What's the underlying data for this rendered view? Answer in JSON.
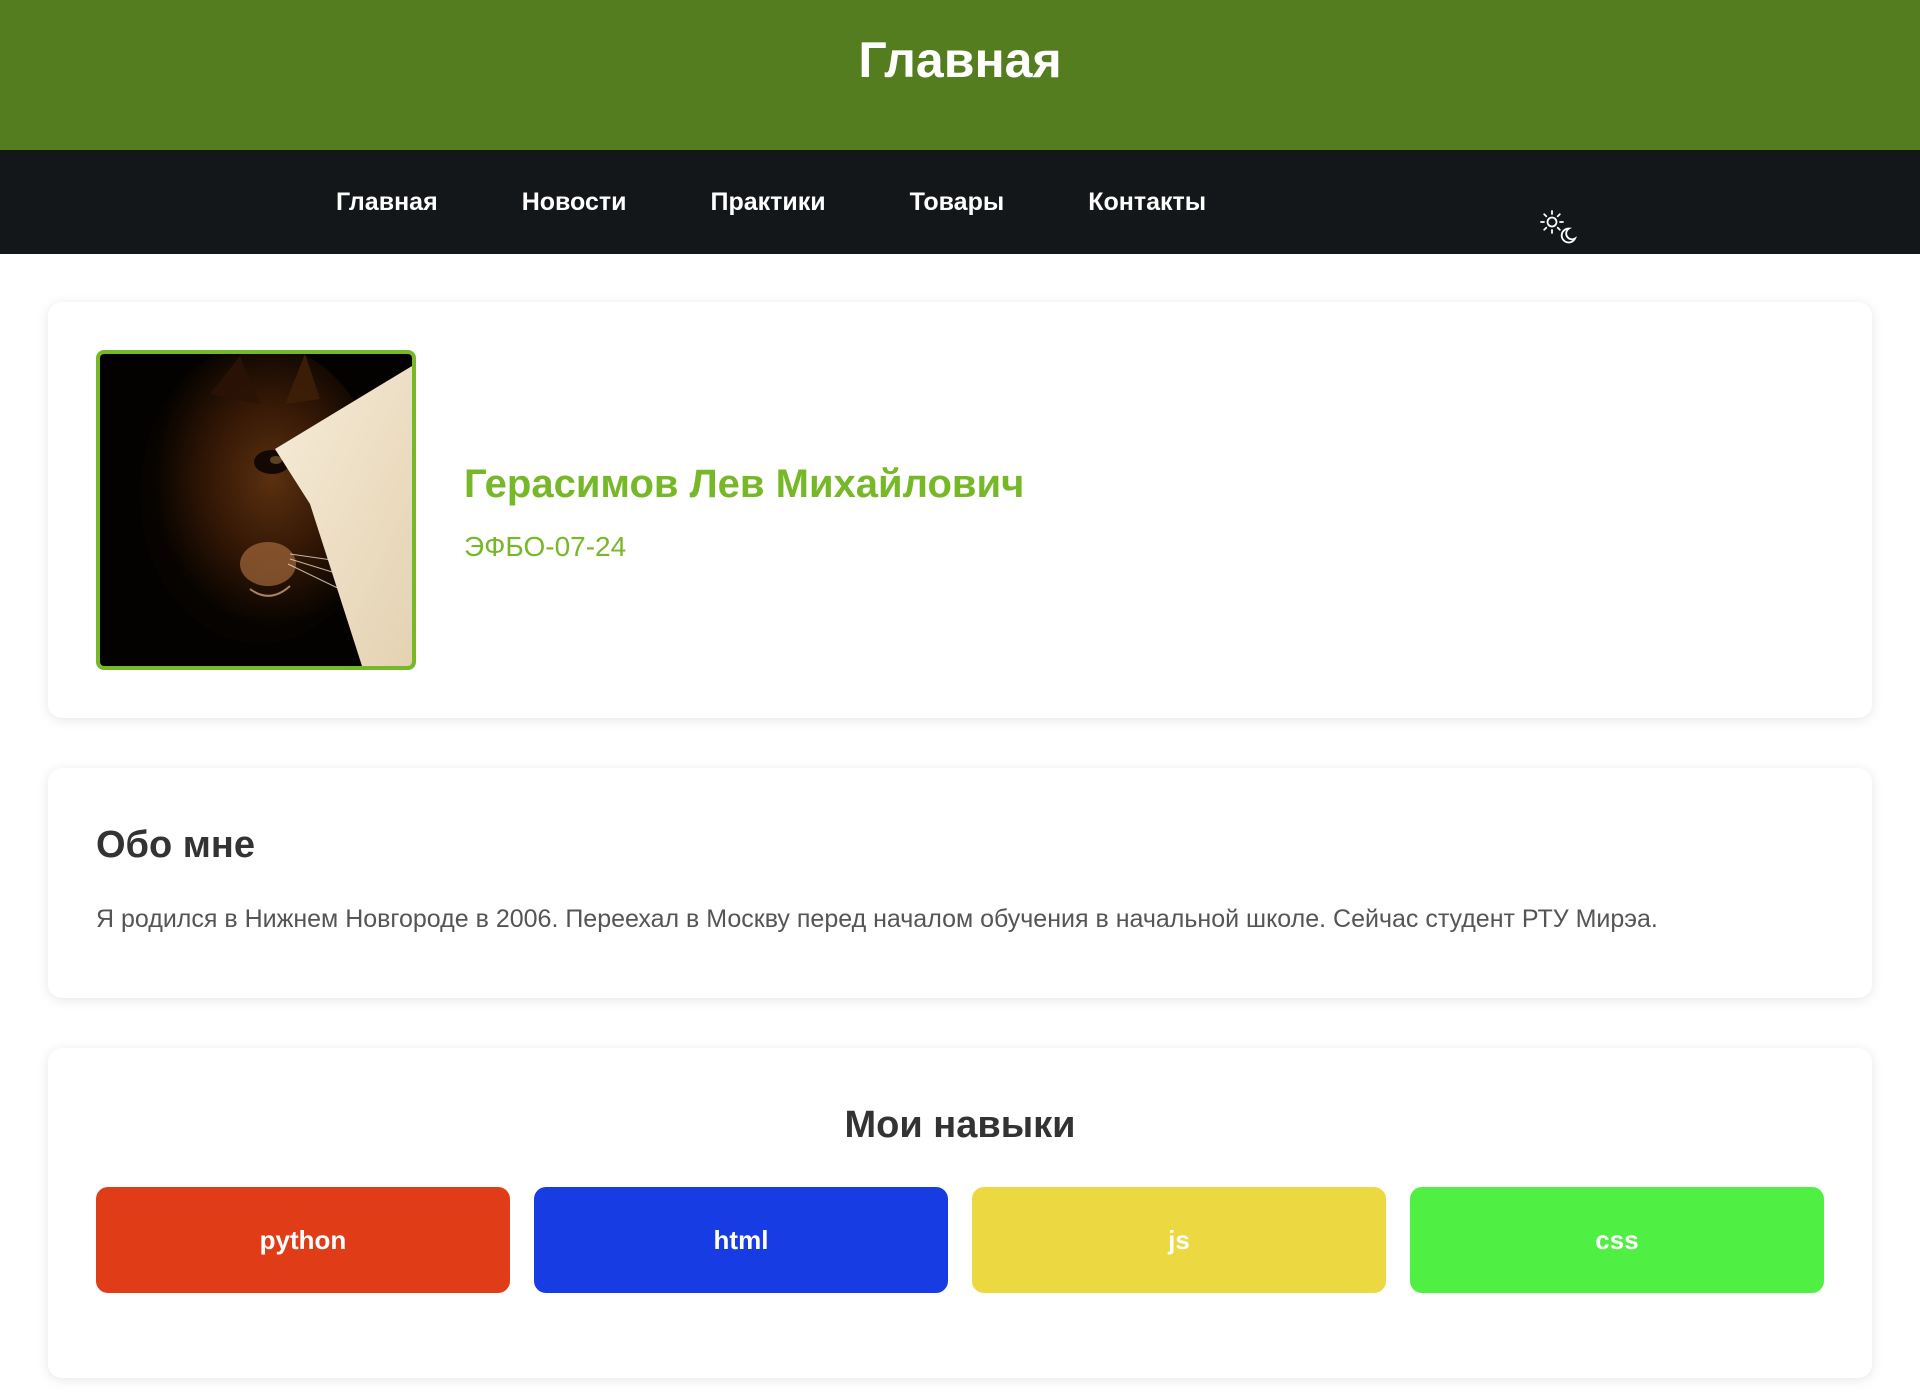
{
  "header": {
    "title": "Главная",
    "background_color": "#547d1f"
  },
  "nav": {
    "items": [
      {
        "label": "Главная"
      },
      {
        "label": "Новости"
      },
      {
        "label": "Практики"
      },
      {
        "label": "Товары"
      },
      {
        "label": "Контакты"
      }
    ],
    "theme_toggle_icon": "sun-moon-icon",
    "background_color": "#141719"
  },
  "profile": {
    "name": "Герасимов Лев Михайлович",
    "group": "ЭФБО-07-24",
    "avatar_icon": "cat-photo",
    "accent_color": "#77b828"
  },
  "about": {
    "title": "Обо мне",
    "text": "Я родился в Нижнем Новгороде в 2006. Переехал в Москву перед началом обучения в начальной школе. Сейчас студент РТУ Мирэа."
  },
  "skills": {
    "title": "Мои навыки",
    "items": [
      {
        "label": "python",
        "color": "#e03c17"
      },
      {
        "label": "html",
        "color": "#183ce4"
      },
      {
        "label": "js",
        "color": "#ecd841"
      },
      {
        "label": "css",
        "color": "#50ef43"
      }
    ]
  }
}
